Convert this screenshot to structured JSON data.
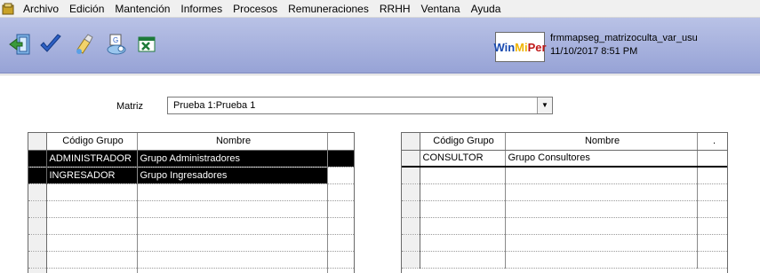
{
  "menu": [
    "Archivo",
    "Edición",
    "Mantención",
    "Informes",
    "Procesos",
    "Remuneraciones",
    "RRHH",
    "Ventana",
    "Ayuda"
  ],
  "toolbar": {
    "buttons": [
      "exit-icon",
      "check-icon",
      "clean-icon",
      "print-preview-icon",
      "excel-icon"
    ],
    "logo": {
      "w": "Win",
      "m": "Mi",
      "p": "Per"
    },
    "form_name": "frmmapseg_matrizoculta_var_usu",
    "timestamp": "11/10/2017 8:51 PM"
  },
  "matriz": {
    "label": "Matriz",
    "value": "Prueba 1:Prueba 1"
  },
  "left_grid": {
    "headers": [
      "Código Grupo",
      "Nombre",
      ""
    ],
    "rows": [
      [
        "ADMINISTRADOR",
        "Grupo Administradores"
      ],
      [
        "INGRESADOR",
        "Grupo Ingresadores"
      ]
    ]
  },
  "right_grid": {
    "headers": [
      "Código Grupo",
      "Nombre",
      "."
    ],
    "rows": [
      [
        "CONSULTOR",
        "Grupo Consultores"
      ]
    ]
  }
}
